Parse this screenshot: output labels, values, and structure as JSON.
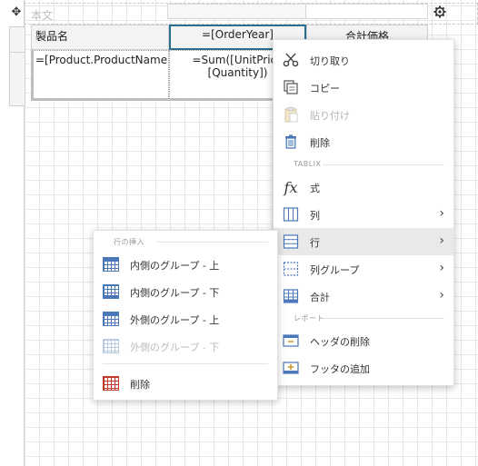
{
  "report": {
    "body_label": "本文",
    "header_cells": [
      "製品名",
      "=[OrderYear]",
      "合計価格"
    ],
    "detail_cells": [
      "=[Product.ProductName]",
      "=Sum([UnitPrice\n[Quantity])"
    ]
  },
  "context_menu": {
    "cut": "切り取り",
    "copy": "コピー",
    "paste": "貼り付け",
    "delete": "削除",
    "tablix_section": "TABLIX",
    "expression": "式",
    "column": "列",
    "row": "行",
    "column_group": "列グループ",
    "total": "合計",
    "report_section": "レポート",
    "remove_header": "ヘッダの削除",
    "add_footer": "フッタの追加"
  },
  "submenu": {
    "section": "行の挿入",
    "inside_above": "内側のグループ - 上",
    "inside_below": "内側のグループ - 下",
    "outside_above": "外側のグループ - 上",
    "outside_below": "外側のグループ - 下",
    "delete": "削除"
  },
  "icons": {
    "move": "move-icon",
    "settings": "gear-icon",
    "cut": "scissors-icon",
    "copy": "copy-icon",
    "paste": "paste-icon",
    "delete": "trash-icon",
    "expression": "fx-icon",
    "column": "column-icon",
    "row": "row-icon",
    "column_group": "column-group-icon",
    "total": "total-icon",
    "header": "header-icon",
    "footer": "footer-icon",
    "grid": "table-grid-icon"
  },
  "colors": {
    "accent": "#2b6f8e",
    "icon_blue": "#4a78b8",
    "danger": "#c0392b",
    "hover": "#e9e9e9"
  }
}
